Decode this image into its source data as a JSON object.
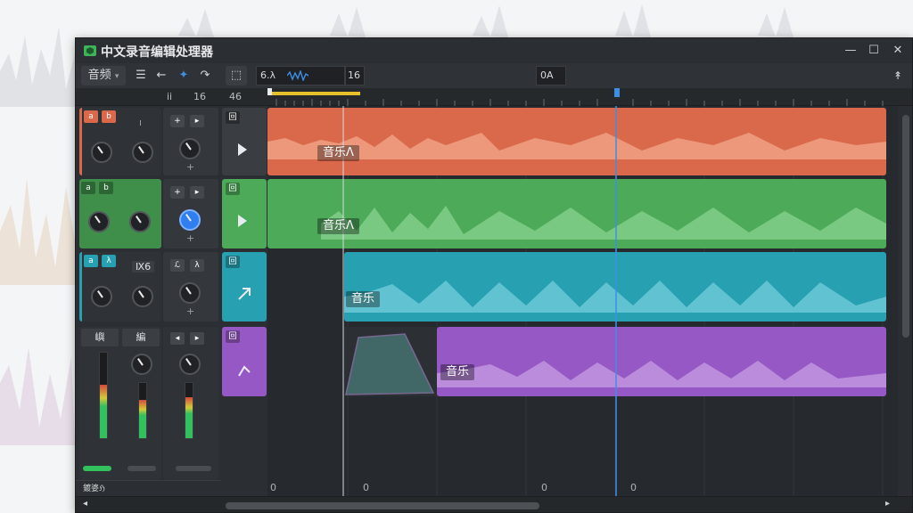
{
  "app": {
    "title": "中文录音编辑处理器",
    "logo_icon": "app-logo-icon",
    "window_controls": {
      "minimize": "—",
      "maximize": "☐",
      "close": "✕"
    }
  },
  "toolbar": {
    "menu_label": "音频",
    "menu_arrow": "▾",
    "list_icon": "☰",
    "back_label": "←",
    "cursor_icon": "✦",
    "redo_label": "↷",
    "save_icon": "⬚",
    "position_field": "6.λ",
    "bpm_field": "16",
    "marker_label": "0A",
    "right_icon": "↟"
  },
  "ruler": {
    "labels": [
      "ii",
      "16",
      "46"
    ]
  },
  "tracks": [
    {
      "name": "音乐Λ",
      "color": "#d9694a",
      "badge_a": "a",
      "badge_b": "b",
      "control_label": "ı",
      "head_btn_a": "+",
      "head_btn_b": "▸",
      "head_sub": "+",
      "head_icon": "回"
    },
    {
      "name": "音乐Λ",
      "color": "#4caa58",
      "badge_a": "a",
      "badge_b": "b",
      "control_label": "",
      "head_btn_a": "+",
      "head_btn_b": "▸",
      "head_sub": "+",
      "head_icon": "回"
    },
    {
      "name": "音乐",
      "color": "#27a0b2",
      "badge_a": "a",
      "badge_b": "λ",
      "control_label": "Ⅸ6",
      "head_btn_a": "ℒ",
      "head_btn_b": "λ",
      "head_sub": "+",
      "head_icon": "回"
    },
    {
      "name": "音乐",
      "color": "#9658c4",
      "badge_a": "",
      "badge_b": "",
      "control_label": "",
      "mixer_label_1": "嶼",
      "mixer_label_2": "編",
      "head_btn_a": "◂",
      "head_btn_b": "▸",
      "head_sub": "",
      "head_icon": "回"
    }
  ],
  "bottom": {
    "status_text": "鍍婆ℌ",
    "timeline_labels": [
      "0",
      "0",
      "0",
      "0"
    ],
    "scroll_left": "◂",
    "scroll_right": "▸"
  },
  "colors": {
    "playhead": "#3d8fe6",
    "loop": "#e6c12a"
  }
}
